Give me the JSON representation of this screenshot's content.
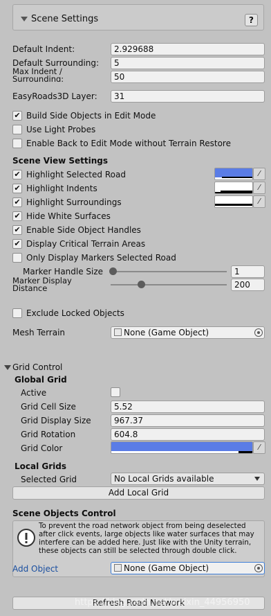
{
  "scene_settings": {
    "title": "Scene Settings",
    "help_label": "?"
  },
  "fields": {
    "default_indent": {
      "label": "Default Indent:",
      "value": "2.929688"
    },
    "default_surrounding": {
      "label": "Default Surrounding:",
      "value": "5"
    },
    "max_indent": {
      "label": "Max Indent / Surrounding:",
      "value": "50"
    },
    "layer": {
      "label": "EasyRoads3D Layer:",
      "value": "31"
    }
  },
  "toggles_top": [
    {
      "label": "Build Side Objects in Edit Mode",
      "checked": true
    },
    {
      "label": "Use Light Probes",
      "checked": false
    },
    {
      "label": "Enable Back to Edit Mode without Terrain Restore",
      "checked": false
    }
  ],
  "scene_view": {
    "heading": "Scene View Settings",
    "color_items": [
      {
        "label": "Highlight Selected Road",
        "checked": true,
        "color": "#5a7ce6"
      },
      {
        "label": "Highlight Indents",
        "checked": true,
        "color": "#ffffff"
      },
      {
        "label": "Highlight Surroundings",
        "checked": true,
        "color": "#ffffff"
      }
    ],
    "items": [
      {
        "label": "Hide White Surfaces",
        "checked": true
      },
      {
        "label": "Enable Side Object Handles",
        "checked": true
      },
      {
        "label": "Display Critical Terrain Areas",
        "checked": true
      },
      {
        "label": "Only Display Markers Selected Road",
        "checked": false
      }
    ],
    "marker_handle_size": {
      "label": "Marker Handle Size",
      "value": "1",
      "fraction": 0.0
    },
    "marker_display_distance": {
      "label": "Marker Display Distance",
      "value": "200",
      "fraction": 0.25
    }
  },
  "exclude_locked": {
    "label": "Exclude Locked Objects",
    "checked": false
  },
  "mesh_terrain": {
    "label": "Mesh Terrain",
    "value": "None (Game Object)"
  },
  "grid_control": {
    "title": "Grid Control",
    "global_heading": "Global Grid",
    "active": {
      "label": "Active",
      "checked": false
    },
    "cell_size": {
      "label": "Grid Cell Size",
      "value": "5.52"
    },
    "display_size": {
      "label": "Grid Display Size",
      "value": "967.37"
    },
    "rotation": {
      "label": "Grid Rotation",
      "value": "604.8"
    },
    "color": {
      "label": "Grid Color",
      "color": "#5a7ce6"
    },
    "local_heading": "Local Grids",
    "selected_grid": {
      "label": "Selected Grid",
      "value": "No Local Grids available"
    },
    "add_local_grid": "Add Local Grid"
  },
  "scene_objects": {
    "heading": "Scene Objects Control",
    "help_text": "To prevent the road network object from being deselected after click events, large objects like water surfaces that may interfere can be added here. Just like with the Unity terrain, these objects can still be selected through double click.",
    "add_object_label": "Add Object",
    "add_object_value": "None (Game Object)"
  },
  "refresh_button": "Refresh Road Network",
  "watermark": "https://blog.csdn.net/weixin_44956950"
}
